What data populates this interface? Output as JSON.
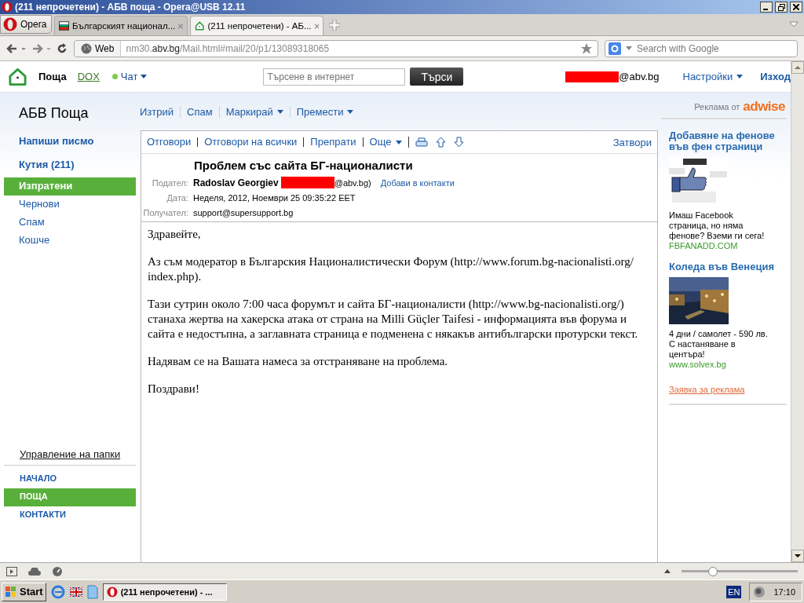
{
  "window": {
    "title": "(211 непрочетени) - АБВ поща - Opera@USB 12.11"
  },
  "browser": {
    "menu_button": "Opera",
    "tabs": [
      {
        "label": "Българският национал...",
        "selected": false,
        "kind": "flag"
      },
      {
        "label": "(211 непрочетени) - АБ...",
        "selected": true,
        "kind": "home"
      }
    ],
    "address": {
      "badge": "Web",
      "url_prefix": "nm30.",
      "url_domain": "abv.bg",
      "url_path": "/Mail.html#mail/20/p1/13089318065"
    },
    "search_placeholder": "Search with Google"
  },
  "header": {
    "nav": [
      {
        "label": "Поща",
        "selected": true
      },
      {
        "label": "DOX",
        "selected": false
      }
    ],
    "chat": {
      "label": "Чат",
      "online": true
    },
    "search": {
      "placeholder": "Търсене в интернет",
      "button": "Търси"
    },
    "account": "@abv.bg",
    "settings": "Настройки",
    "logout": "Изход"
  },
  "sidebar": {
    "title": "АБВ Поща",
    "compose": "Напиши писмо",
    "folders": [
      {
        "label": "Кутия (211)",
        "kind": "inbox",
        "selected": false
      },
      {
        "label": "Изпратени",
        "kind": "folder",
        "selected": true
      },
      {
        "label": "Чернови",
        "kind": "folder",
        "selected": false
      },
      {
        "label": "Спам",
        "kind": "folder",
        "selected": false
      },
      {
        "label": "Кошче",
        "kind": "folder",
        "selected": false
      }
    ],
    "manage": "Управление на папки",
    "sections": [
      {
        "label": "НАЧАЛО",
        "selected": false
      },
      {
        "label": "ПОЩА",
        "selected": true
      },
      {
        "label": "КОНТАКТИ",
        "selected": false
      }
    ]
  },
  "toolbar": [
    {
      "label": "Изтрий",
      "dropdown": false
    },
    {
      "label": "Спам",
      "dropdown": false
    },
    {
      "label": "Маркирай",
      "dropdown": true
    },
    {
      "label": "Премести",
      "dropdown": true
    }
  ],
  "message": {
    "actions": [
      {
        "label": "Отговори",
        "dropdown": false
      },
      {
        "label": "Отговори на всички",
        "dropdown": false
      },
      {
        "label": "Препрати",
        "dropdown": false
      },
      {
        "label": "Още",
        "dropdown": true
      }
    ],
    "close": "Затвори",
    "subject": "Проблем със сайта БГ-националисти",
    "fields": [
      {
        "label": "Подател:",
        "kind": "sender",
        "value": "Radoslav Georgiev",
        "suffix": "@abv.bg)",
        "action": "Добави в контакти"
      },
      {
        "label": "Дата:",
        "kind": "plain",
        "value": "Неделя, 2012, Ноември 25 09:35:22 EET"
      },
      {
        "label": "Получател:",
        "kind": "plain",
        "value": "support@supersupport.bg"
      }
    ],
    "body": [
      "Здравейте,",
      "Аз съм модератор в Българския Националистически Форум (http://www.forum.bg-nacionalisti.org/ index.php).",
      "Тази сутрин около 7:00 часа форумът и сайта БГ-националисти (http://www.bg-nacionalisti.org/) станаха жертва на хакерска атака от страна на Milli Güçler Taifesi - информацията във форума и сайта е недостъпна, а заглавната страница е подменена с някакъв антибългарски протурски текст.",
      "Надявам се на Вашата намеса за отстраняване на проблема.",
      "Поздрави!"
    ]
  },
  "ads": {
    "label": "Реклама от",
    "brand": "adwise",
    "items": [
      {
        "title": "Добавяне на фенове във фен страници",
        "kind": "like",
        "text": "Имаш Facebook страница, но няма фенове? Вземи ги сега!",
        "link": "FBFANADD.COM"
      },
      {
        "title": "Коледа във Венеция",
        "text": "4 дни / самолет - 590 лв. С настаняване в центъра!",
        "link": "www.solvex.bg"
      }
    ],
    "request": "Заявка за реклама"
  },
  "status_bar": {
    "zoom": {
      "level": 0.27
    }
  },
  "taskbar": {
    "start": "Start",
    "task": "(211 непрочетени) - ...",
    "language": "EN",
    "clock": "17:10"
  }
}
